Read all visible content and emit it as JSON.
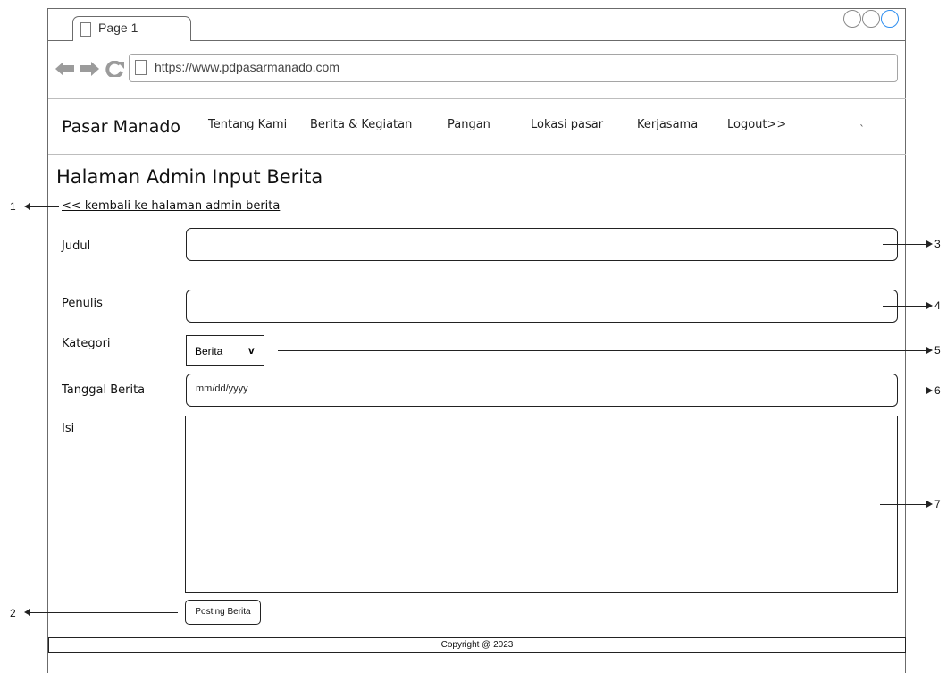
{
  "browser": {
    "tab_title": "Page 1",
    "url": "https://www.pdpasarmanado.com"
  },
  "header": {
    "brand": "Pasar Manado",
    "menu": [
      "Tentang Kami",
      "Berita & Kegiatan",
      "Pangan",
      "Lokasi pasar",
      "Kerjasama",
      "Logout>>"
    ],
    "stray_mark": "`"
  },
  "page": {
    "title": "Halaman Admin Input Berita",
    "back_link": "<< kembali ke halaman admin berita"
  },
  "form": {
    "judul_label": "Judul",
    "penulis_label": "Penulis",
    "kategori_label": "Kategori",
    "kategori_value": "Berita",
    "kategori_chevron": "v",
    "tanggal_label": "Tanggal Berita",
    "tanggal_value": "mm/dd/yyyy",
    "isi_label": "Isi",
    "submit_label": "Posting Berita"
  },
  "footer": {
    "copyright": "Copyright @ 2023"
  },
  "annotations": [
    "1",
    "2",
    "3",
    "4",
    "5",
    "6",
    "7"
  ],
  "colors": {
    "border": "#222222",
    "frame": "#6b6b6b",
    "active_window_button": "#2f8ff0"
  }
}
